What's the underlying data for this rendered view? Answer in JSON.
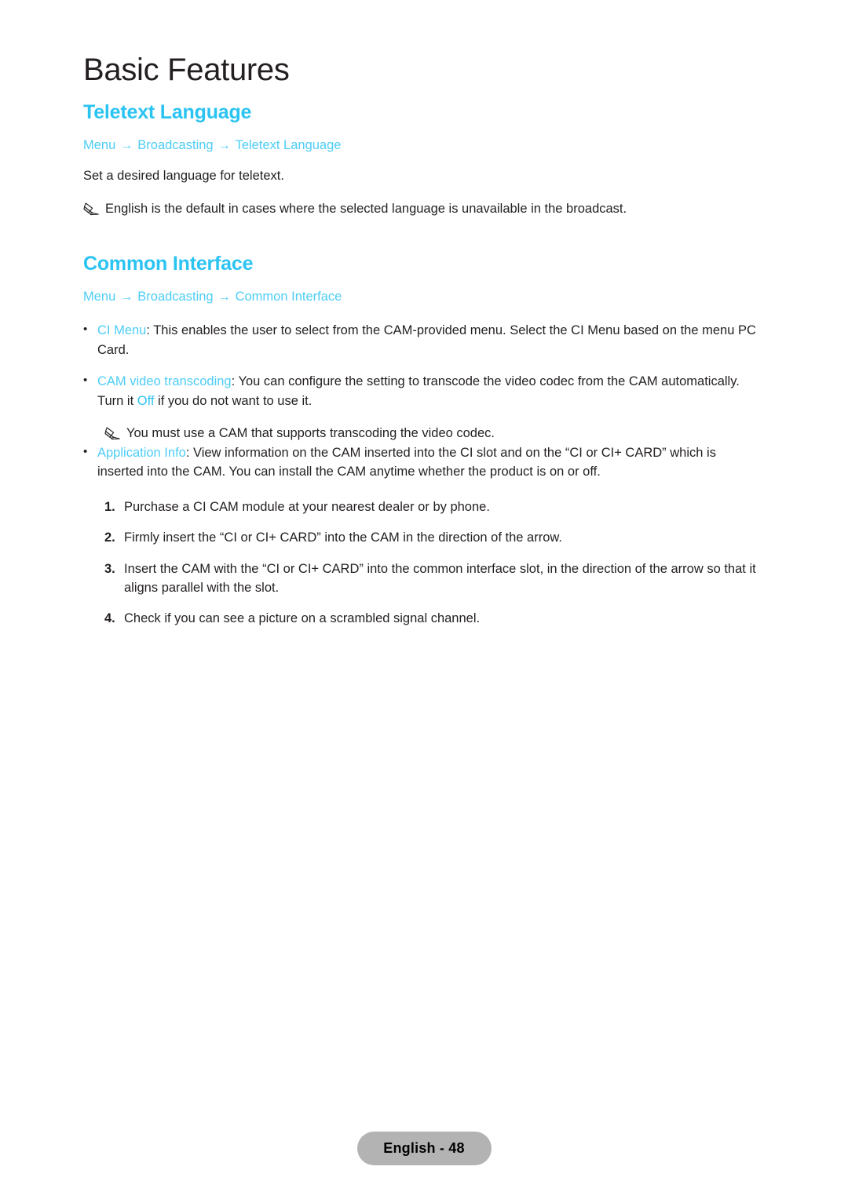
{
  "chapter": {
    "title": "Basic Features"
  },
  "sections": [
    {
      "heading": "Teletext Language",
      "breadcrumb": {
        "items": [
          "Menu",
          "Broadcasting",
          "Teletext Language"
        ],
        "separator": "→"
      },
      "paragraph": "Set a desired language for teletext.",
      "note": "English is the default in cases where the selected language is unavailable in the broadcast."
    },
    {
      "heading": "Common Interface",
      "breadcrumb": {
        "items": [
          "Menu",
          "Broadcasting",
          "Common Interface"
        ],
        "separator": "→"
      }
    }
  ],
  "bullets": [
    {
      "marker": "•",
      "term": "CI Menu",
      "text": ": This enables the user to select from the CAM-provided menu. Select the CI Menu based on the menu PC Card."
    },
    {
      "marker": "•",
      "term": "CAM video transcoding",
      "text_before_highlight": ": You can configure the setting to transcode the video codec from the CAM automatically. Turn it ",
      "highlight": "Off",
      "text_after_highlight": " if you do not want to use it.",
      "note": "You must use a CAM that supports transcoding the video codec."
    },
    {
      "marker": "•",
      "term": "Application Info",
      "text": ": View information on the CAM inserted into the CI slot and on the “CI or CI+ CARD” which is inserted into the CAM. You can install the CAM anytime whether the product is on or off."
    }
  ],
  "steps": [
    {
      "number": "1.",
      "text": "Purchase a CI CAM module at your nearest dealer or by phone."
    },
    {
      "number": "2.",
      "text": "Firmly insert the “CI or CI+ CARD” into the CAM in the direction of the arrow."
    },
    {
      "number": "3.",
      "text": "Insert the CAM with the “CI or CI+ CARD” into the common interface slot, in the direction of the arrow so that it aligns parallel with the slot."
    },
    {
      "number": "4.",
      "text": "Check if you can see a picture on a scrambled signal channel."
    }
  ],
  "footer": {
    "page_label": "English - 48"
  },
  "colors": {
    "heading_cyan": "#2bc3f2",
    "breadcrumb_cyan": "#4dcdf5",
    "body_text": "#231f20",
    "badge_bg": "#b3b3b3"
  }
}
